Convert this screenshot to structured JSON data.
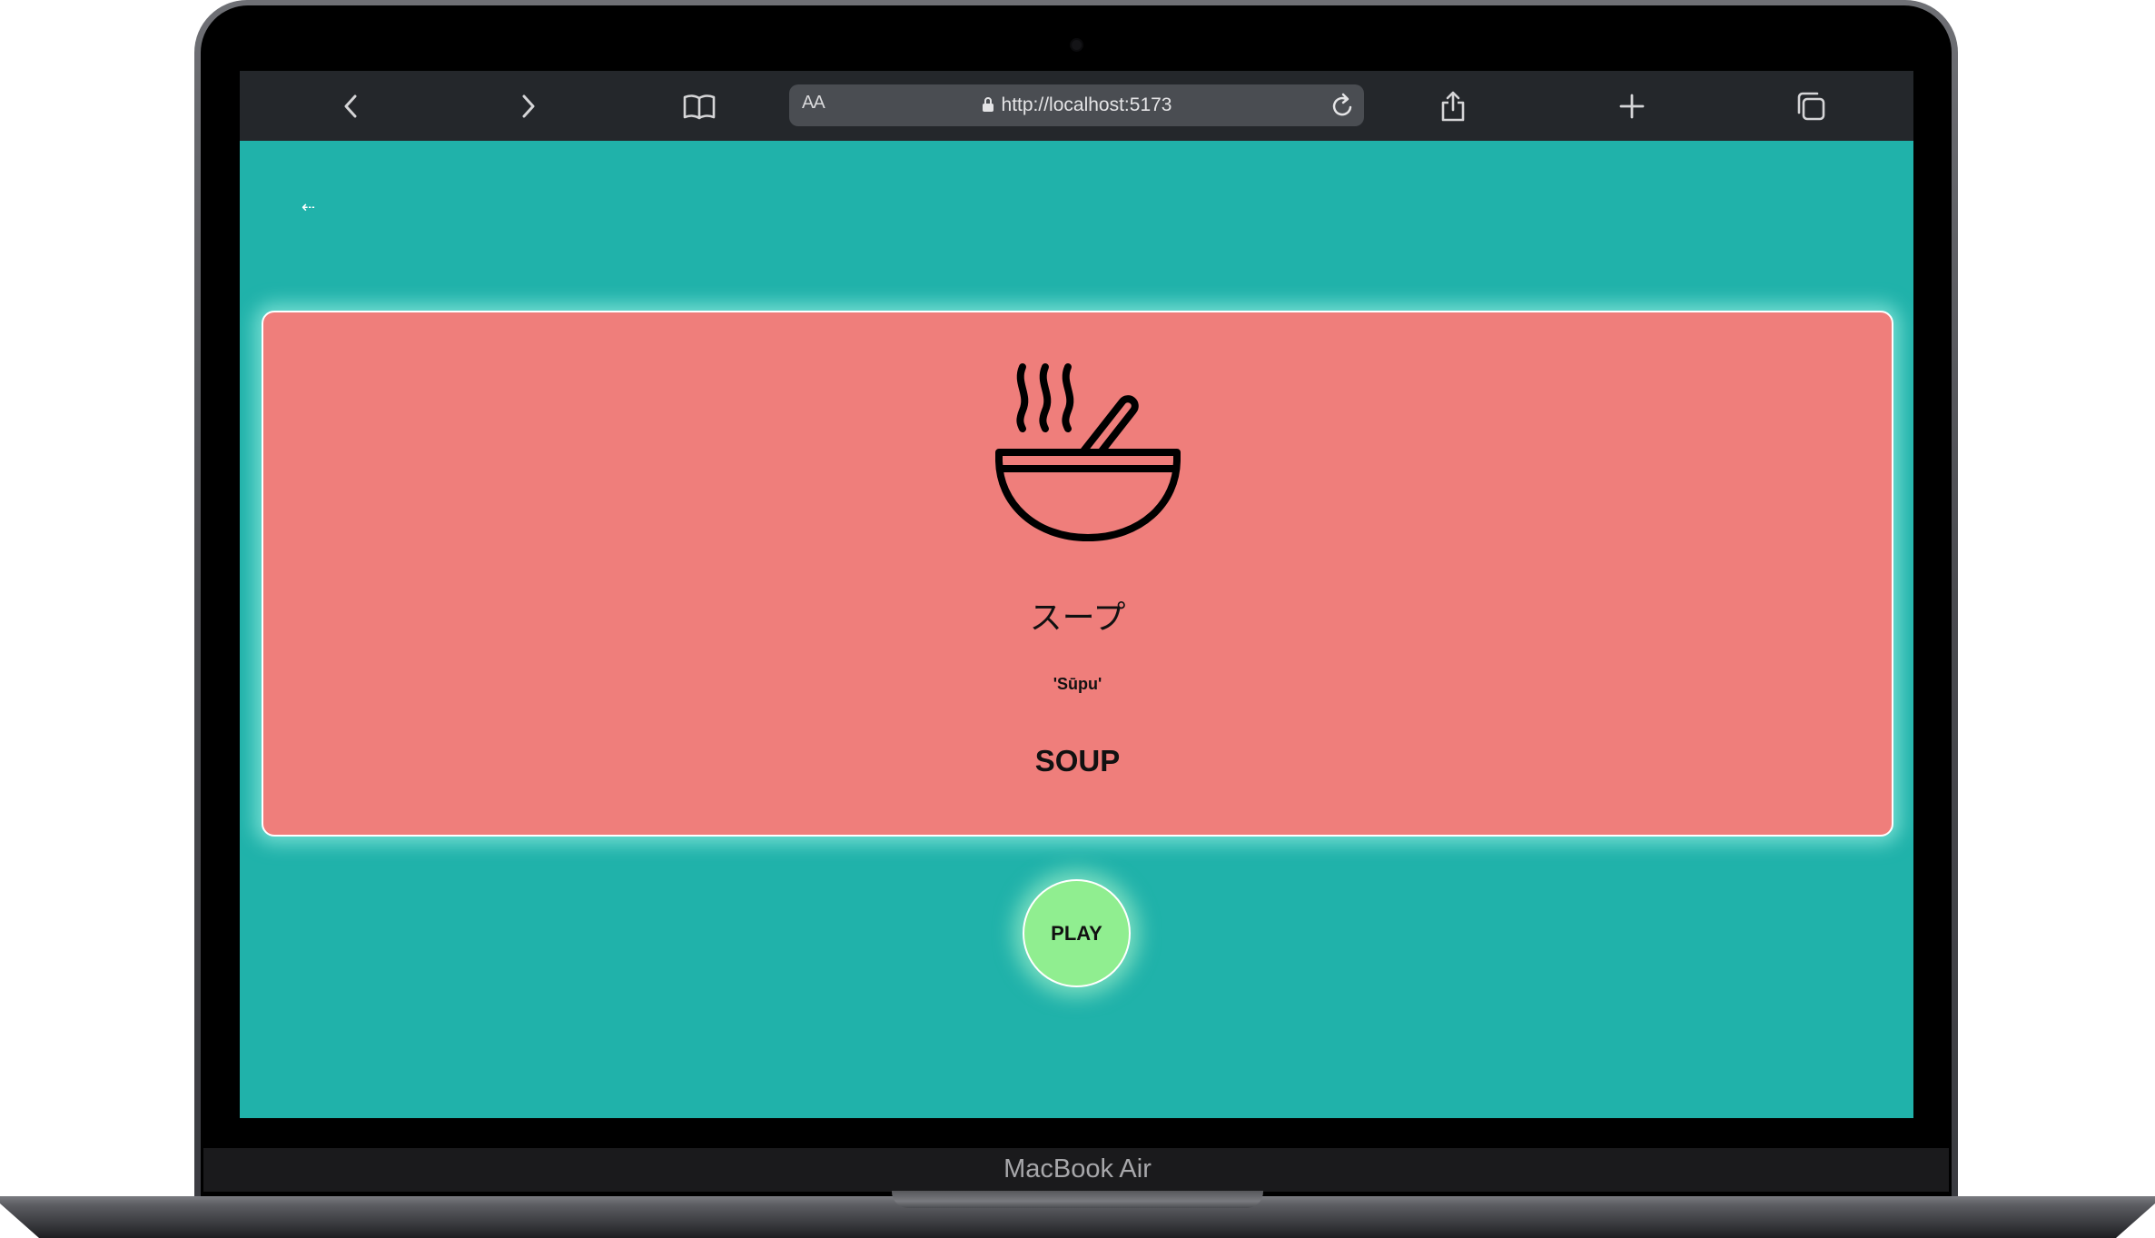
{
  "device": {
    "label": "MacBook Air"
  },
  "browser": {
    "text_size_label": "AA",
    "url": "http://localhost:5173",
    "icons": {
      "back": "chevron-left-icon",
      "forward": "chevron-right-icon",
      "bookmarks": "book-icon",
      "secure": "lock-icon",
      "reload": "reload-icon",
      "share": "share-icon",
      "new_tab": "plus-icon",
      "tabs": "tabs-icon"
    }
  },
  "page": {
    "back_link": "⇠",
    "card": {
      "icon": "soup-bowl-icon",
      "japanese": "スープ",
      "romaji": "'Sūpu'",
      "english": "SOUP"
    },
    "play_button": "PLAY"
  },
  "colors": {
    "page_background": "#20b2aa",
    "card_background": "#ef7e7b",
    "play_button": "#90ee90",
    "toolbar": "#24272b"
  }
}
